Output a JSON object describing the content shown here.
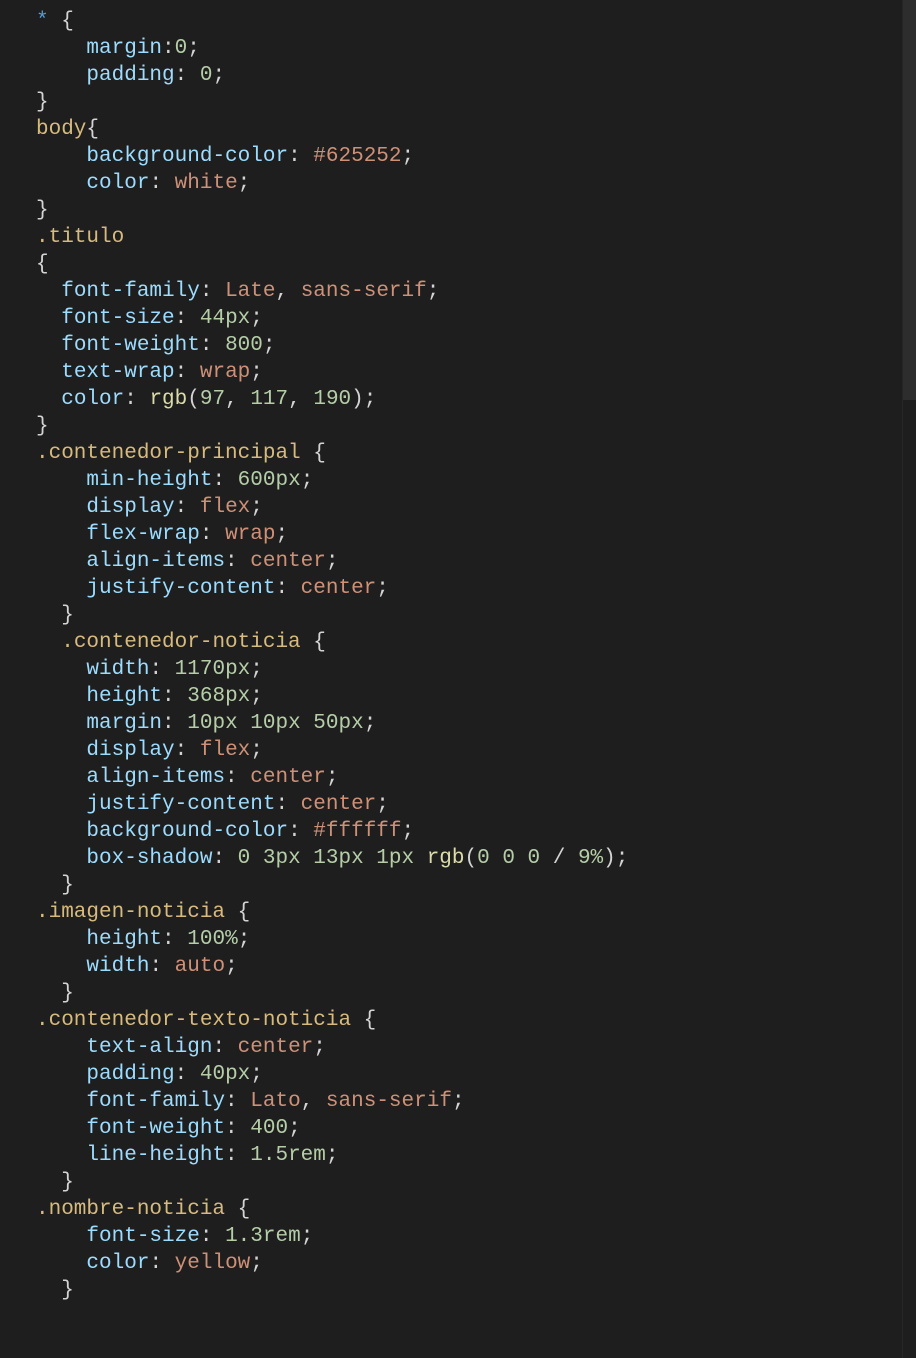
{
  "code": {
    "l1": {
      "sel": "*",
      "brace": "{"
    },
    "l2": {
      "prop": "margin",
      "colon": ":",
      "val": "0",
      "semi": ";"
    },
    "l3": {
      "prop": "padding",
      "colon": ": ",
      "val": "0",
      "semi": ";"
    },
    "l4": {
      "brace": "}"
    },
    "l5": {
      "sel": "body",
      "brace": "{"
    },
    "l6": {
      "prop": "background-color",
      "colon": ": ",
      "val": "#625252",
      "semi": ";"
    },
    "l7": {
      "prop": "color",
      "colon": ": ",
      "val": "white",
      "semi": ";"
    },
    "l8": {
      "brace": "}"
    },
    "l9": {
      "sel": ".titulo"
    },
    "l10": {
      "brace": "{"
    },
    "l11": {
      "prop": "font-family",
      "colon": ": ",
      "val": "Late",
      "comma": ", ",
      "val2": "sans-serif",
      "semi": ";"
    },
    "l12": {
      "prop": "font-size",
      "colon": ": ",
      "val": "44px",
      "semi": ";"
    },
    "l13": {
      "prop": "font-weight",
      "colon": ": ",
      "val": "800",
      "semi": ";"
    },
    "l14": {
      "prop": "text-wrap",
      "colon": ": ",
      "val": "wrap",
      "semi": ";"
    },
    "l15": {
      "prop": "color",
      "colon": ": ",
      "fn": "rgb",
      "open": "(",
      "a": "97",
      "c1": ", ",
      "b": "117",
      "c2": ", ",
      "c": "190",
      "close": ")",
      "semi": ";"
    },
    "l16": {
      "brace": "}"
    },
    "l17": {
      "sel": ".contenedor-principal",
      "space": " ",
      "brace": "{"
    },
    "l18": {
      "prop": "min-height",
      "colon": ": ",
      "val": "600px",
      "semi": ";"
    },
    "l19": {
      "prop": "display",
      "colon": ": ",
      "val": "flex",
      "semi": ";"
    },
    "l20": {
      "prop": "flex-wrap",
      "colon": ": ",
      "val": "wrap",
      "semi": ";"
    },
    "l21": {
      "prop": "align-items",
      "colon": ": ",
      "val": "center",
      "semi": ";"
    },
    "l22": {
      "prop": "justify-content",
      "colon": ": ",
      "val": "center",
      "semi": ";"
    },
    "l23": {
      "brace": "}"
    },
    "l24": {
      "sel": ".contenedor-noticia",
      "space": " ",
      "brace": "{"
    },
    "l25": {
      "prop": "width",
      "colon": ": ",
      "val": "1170px",
      "semi": ";"
    },
    "l26": {
      "prop": "height",
      "colon": ": ",
      "val": "368px",
      "semi": ";"
    },
    "l27": {
      "prop": "margin",
      "colon": ": ",
      "val": "10px 10px 50px",
      "semi": ";"
    },
    "l28": {
      "prop": "display",
      "colon": ": ",
      "val": "flex",
      "semi": ";"
    },
    "l29": {
      "prop": "align-items",
      "colon": ": ",
      "val": "center",
      "semi": ";"
    },
    "l30": {
      "prop": "justify-content",
      "colon": ": ",
      "val": "center",
      "semi": ";"
    },
    "l31": {
      "prop": "background-color",
      "colon": ": ",
      "val": "#ffffff",
      "semi": ";"
    },
    "l32": {
      "prop": "box-shadow",
      "colon": ": ",
      "pre": "0 3px 13px 1px ",
      "fn": "rgb",
      "open": "(",
      "args": "0 0 0",
      "slash": " / ",
      "pct": "9%",
      "close": ")",
      "semi": ";"
    },
    "l33": {
      "brace": "}"
    },
    "l34": {
      "sel": ".imagen-noticia",
      "space": " ",
      "brace": "{"
    },
    "l35": {
      "prop": "height",
      "colon": ": ",
      "val": "100%",
      "semi": ";"
    },
    "l36": {
      "prop": "width",
      "colon": ": ",
      "val": "auto",
      "semi": ";"
    },
    "l37": {
      "brace": "}"
    },
    "l38": {
      "sel": ".contenedor-texto-noticia",
      "space": " ",
      "brace": "{"
    },
    "l39": {
      "prop": "text-align",
      "colon": ": ",
      "val": "center",
      "semi": ";"
    },
    "l40": {
      "prop": "padding",
      "colon": ": ",
      "val": "40px",
      "semi": ";"
    },
    "l41": {
      "prop": "font-family",
      "colon": ": ",
      "val": "Lato",
      "comma": ", ",
      "val2": "sans-serif",
      "semi": ";"
    },
    "l42": {
      "prop": "font-weight",
      "colon": ": ",
      "val": "400",
      "semi": ";"
    },
    "l43": {
      "prop": "line-height",
      "colon": ": ",
      "val": "1.5rem",
      "semi": ";"
    },
    "l44": {
      "brace": "}"
    },
    "l45": {
      "sel": ".nombre-noticia",
      "space": " ",
      "brace": "{"
    },
    "l46": {
      "prop": "font-size",
      "colon": ": ",
      "val": "1.3rem",
      "semi": ";"
    },
    "l47": {
      "prop": "color",
      "colon": ": ",
      "val": "yellow",
      "semi": ";"
    },
    "l48": {
      "brace": "}"
    }
  }
}
